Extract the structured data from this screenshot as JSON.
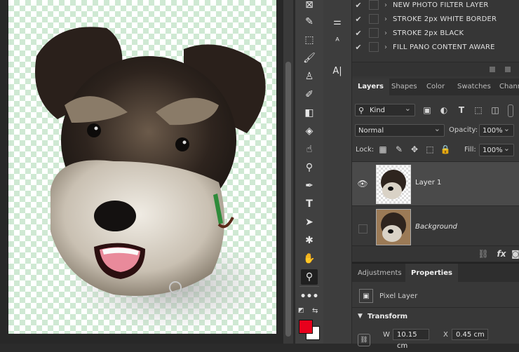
{
  "actions": {
    "items": [
      {
        "label": "NEW PHOTO FILTER LAYER",
        "checked": true
      },
      {
        "label": "STROKE 2px WHITE BORDER",
        "checked": true
      },
      {
        "label": "STROKE 2px BLACK",
        "checked": true
      },
      {
        "label": "FILL PANO CONTENT AWARE",
        "checked": true
      }
    ]
  },
  "layers_panel": {
    "tabs": [
      "Layers",
      "Shapes",
      "Color",
      "Swatches",
      "Chann"
    ],
    "active_tab": "Layers",
    "filter_kind": "Kind",
    "blend_mode": "Normal",
    "opacity_label": "Opacity:",
    "opacity_value": "100%",
    "lock_label": "Lock:",
    "fill_label": "Fill:",
    "fill_value": "100%",
    "layers": [
      {
        "name": "Layer 1",
        "visible": true,
        "selected": true
      },
      {
        "name": "Background",
        "visible": false,
        "selected": false
      }
    ]
  },
  "properties_panel": {
    "tabs": [
      "Adjustments",
      "Properties"
    ],
    "active_tab": "Properties",
    "layer_type": "Pixel Layer",
    "section_title": "Transform",
    "w_label": "W",
    "w_value": "10.15 cm",
    "x_label": "X",
    "x_value": "0.45 cm"
  },
  "colors": {
    "foreground": "#e8001c",
    "background": "#ffffff",
    "transparency_check": "#cfe9d3"
  },
  "icons": {
    "toolbar": [
      "crop-icon",
      "eyedropper-icon",
      "frame-icon",
      "brush-icon",
      "clone-stamp-icon",
      "history-brush-icon",
      "eraser-icon",
      "paint-bucket-icon",
      "smudge-icon",
      "dodge-icon",
      "pen-icon",
      "type-icon",
      "path-select-icon",
      "custom-shape-icon",
      "hand-icon",
      "zoom-icon",
      "more-tools-icon"
    ]
  }
}
